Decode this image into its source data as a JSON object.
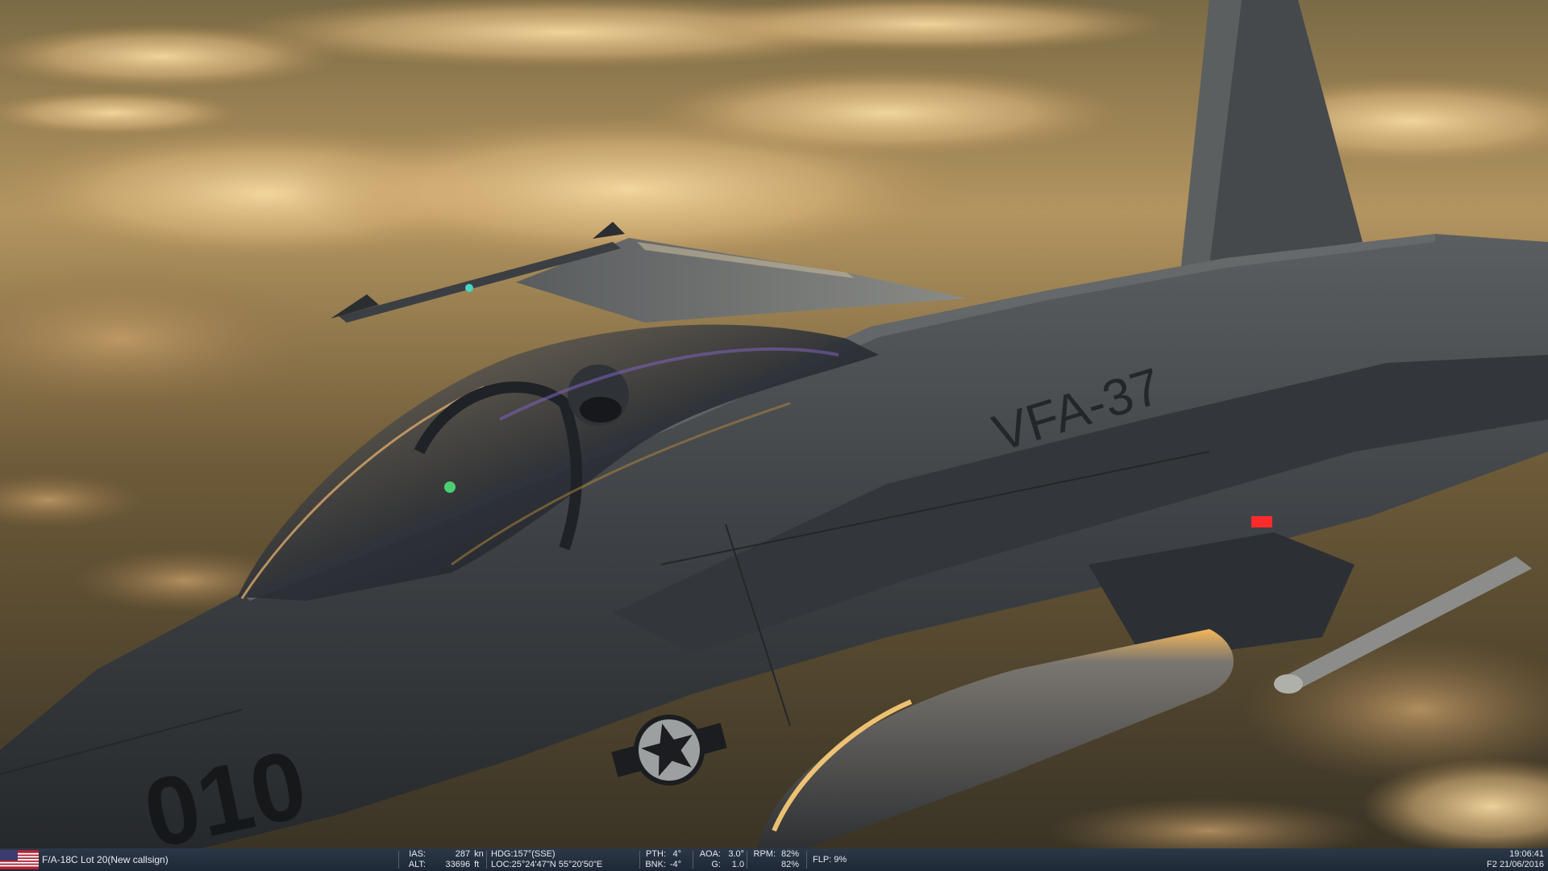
{
  "scene": {
    "tail_code": "VFA-37",
    "modex": "010",
    "description_icons": [
      "us-roundel-icon"
    ]
  },
  "hud": {
    "flag_icon": "usa-flag-icon",
    "aircraft_name": "F/A-18C Lot 20(New callsign)",
    "ias_label": "IAS:",
    "ias_value": "287",
    "ias_unit": "kn",
    "alt_label": "ALT:",
    "alt_value": "33696",
    "alt_unit": "ft",
    "hdg": "HDG:157°(SSE)",
    "loc": "LOC:25°24'47\"N 55°20'50\"E",
    "pth_label": "PTH:",
    "pth_value": "4°",
    "bnk_label": "BNK:",
    "bnk_value": "-4°",
    "aoa_label": "AOA:",
    "aoa_value": "3.0°",
    "g_label": "G:",
    "g_value": "1.0",
    "rpm_label": "RPM:",
    "rpm_value_1": "82%",
    "rpm_value_2": "82%",
    "flp": "FLP: 9%",
    "time": "19:06:41",
    "date": "F2 21/06/2016"
  },
  "colors": {
    "hud_background": "#253142",
    "hud_text": "#e6e9ee",
    "sky_glow": "#f2c98a",
    "jet_body": "#3e4348"
  }
}
